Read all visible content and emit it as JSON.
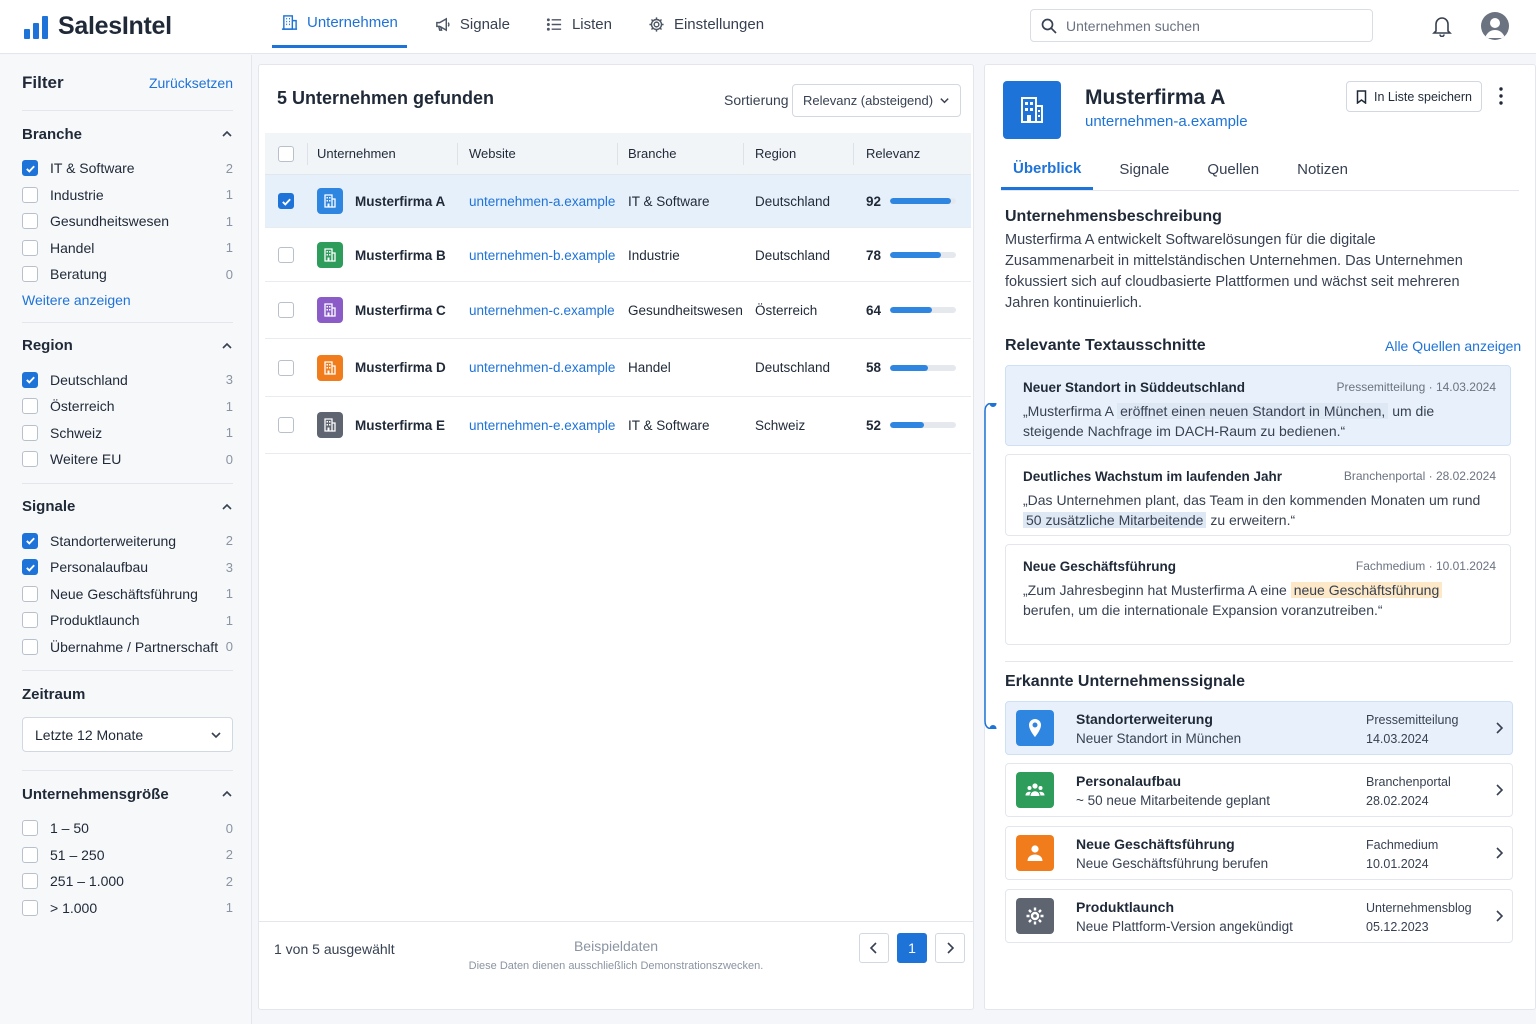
{
  "app": {
    "name": "SalesIntel",
    "brand_color": "#1e73d8"
  },
  "nav": {
    "items": [
      {
        "label": "Unternehmen",
        "icon": "building-icon",
        "active": true
      },
      {
        "label": "Signale",
        "icon": "megaphone-icon"
      },
      {
        "label": "Listen",
        "icon": "list-icon"
      },
      {
        "label": "Einstellungen",
        "icon": "gear-icon"
      }
    ]
  },
  "search": {
    "placeholder": "Unternehmen suchen"
  },
  "filters": {
    "title": "Filter",
    "reset": "Zurücksetzen",
    "branche": {
      "title": "Branche",
      "items": [
        {
          "label": "IT & Software",
          "count": "2",
          "checked": true
        },
        {
          "label": "Industrie",
          "count": "1",
          "checked": false
        },
        {
          "label": "Gesundheitswesen",
          "count": "1",
          "checked": false
        },
        {
          "label": "Handel",
          "count": "1",
          "checked": false
        },
        {
          "label": "Beratung",
          "count": "0",
          "checked": false
        }
      ],
      "more": "Weitere anzeigen"
    },
    "region": {
      "title": "Region",
      "items": [
        {
          "label": "Deutschland",
          "count": "3",
          "checked": true
        },
        {
          "label": "Österreich",
          "count": "1",
          "checked": false
        },
        {
          "label": "Schweiz",
          "count": "1",
          "checked": false
        },
        {
          "label": "Weitere EU",
          "count": "0",
          "checked": false
        }
      ]
    },
    "signale": {
      "title": "Signale",
      "items": [
        {
          "label": "Standorterweiterung",
          "count": "2",
          "checked": true
        },
        {
          "label": "Personalaufbau",
          "count": "3",
          "checked": true
        },
        {
          "label": "Neue Geschäftsführung",
          "count": "1",
          "checked": false
        },
        {
          "label": "Produktlaunch",
          "count": "1",
          "checked": false
        },
        {
          "label": "Übernahme / Partnerschaft",
          "count": "0",
          "checked": false
        }
      ]
    },
    "zeitraum": {
      "title": "Zeitraum",
      "value": "Letzte 12 Monate"
    },
    "groesse": {
      "title": "Unternehmensgröße",
      "items": [
        {
          "label": "1 – 50",
          "count": "0",
          "checked": false
        },
        {
          "label": "51 – 250",
          "count": "2",
          "checked": false
        },
        {
          "label": "251 – 1.000",
          "count": "2",
          "checked": false
        },
        {
          "label": "> 1.000",
          "count": "1",
          "checked": false
        }
      ]
    }
  },
  "results": {
    "title": "5 Unternehmen gefunden",
    "sort_label": "Sortierung",
    "sort_value": "Relevanz (absteigend)",
    "columns": [
      "Unternehmen",
      "Website",
      "Branche",
      "Region",
      "Relevanz"
    ],
    "rows": [
      {
        "name": "Musterfirma A",
        "website": "unternehmen-a.example",
        "branche": "IT & Software",
        "region": "Deutschland",
        "relevanz": "92",
        "score": 92,
        "color": "#2f86e0",
        "selected": true
      },
      {
        "name": "Musterfirma B",
        "website": "unternehmen-b.example",
        "branche": "Industrie",
        "region": "Deutschland",
        "relevanz": "78",
        "score": 78,
        "color": "#2e9d5b",
        "selected": false
      },
      {
        "name": "Musterfirma C",
        "website": "unternehmen-c.example",
        "branche": "Gesundheitswesen",
        "region": "Österreich",
        "relevanz": "64",
        "score": 64,
        "color": "#8b5cc7",
        "selected": false
      },
      {
        "name": "Musterfirma D",
        "website": "unternehmen-d.example",
        "branche": "Handel",
        "region": "Deutschland",
        "relevanz": "58",
        "score": 58,
        "color": "#f07c1b",
        "selected": false
      },
      {
        "name": "Musterfirma E",
        "website": "unternehmen-e.example",
        "branche": "IT & Software",
        "region": "Schweiz",
        "relevanz": "52",
        "score": 52,
        "color": "#5e6470",
        "selected": false
      }
    ],
    "selection_text": "1 von 5 ausgewählt",
    "demo_title": "Beispieldaten",
    "demo_note": "Diese Daten dienen ausschließlich Demonstrationszwecken.",
    "page": "1"
  },
  "detail": {
    "name": "Musterfirma A",
    "url": "unternehmen-a.example",
    "save_label": "In Liste speichern",
    "tabs": [
      "Überblick",
      "Signale",
      "Quellen",
      "Notizen"
    ],
    "desc_title": "Unternehmensbeschreibung",
    "desc": "Musterfirma A entwickelt Softwarelösungen für die digitale Zusammenarbeit in mittelständischen Unternehmen. Das Unternehmen fokussiert sich auf cloudbasierte Plattformen und wächst seit mehreren Jahren kontinuierlich.",
    "snippets_title": "Relevante Textausschnitte",
    "all_sources": "Alle Quellen anzeigen",
    "snippets": [
      {
        "title": "Neuer Standort in Süddeutschland",
        "source": "Pressemitteilung",
        "date": "14.03.2024",
        "pre": "„Musterfirma A ",
        "mark": "eröffnet einen neuen Standort in München,",
        "post": " um die steigende Nachfrage im DACH-Raum zu bedienen.“"
      },
      {
        "title": "Deutliches Wachstum im laufenden Jahr",
        "source": "Branchenportal",
        "date": "28.02.2024",
        "pre": "„Das Unternehmen plant, das Team in den kommenden Monaten um rund ",
        "mark": "50 zusätzliche Mitarbeitende",
        "post": " zu erweitern.“"
      },
      {
        "title": "Neue Geschäftsführung",
        "source": "Fachmedium",
        "date": "10.01.2024",
        "pre": "„Zum Jahresbeginn hat Musterfirma A eine ",
        "mark": "neue Geschäftsführung",
        "post": " berufen, um die internationale Expansion voranzutreiben.“"
      }
    ],
    "signals_title": "Erkannte Unternehmenssignale",
    "signals": [
      {
        "title": "Standorterweiterung",
        "sub": "Neuer Standort in München",
        "source": "Pressemitteilung",
        "date": "14.03.2024",
        "icon": "location-pin-icon",
        "color": "#2f86e0"
      },
      {
        "title": "Personalaufbau",
        "sub": "~ 50 neue Mitarbeitende geplant",
        "source": "Branchenportal",
        "date": "28.02.2024",
        "icon": "people-icon",
        "color": "#2e9d5b"
      },
      {
        "title": "Neue Geschäftsführung",
        "sub": "Neue Geschäftsführung berufen",
        "source": "Fachmedium",
        "date": "10.01.2024",
        "icon": "person-icon",
        "color": "#f07c1b"
      },
      {
        "title": "Produktlaunch",
        "sub": "Neue Plattform-Version angekündigt",
        "source": "Unternehmensblog",
        "date": "05.12.2023",
        "icon": "gear-icon",
        "color": "#5e6470"
      }
    ]
  }
}
